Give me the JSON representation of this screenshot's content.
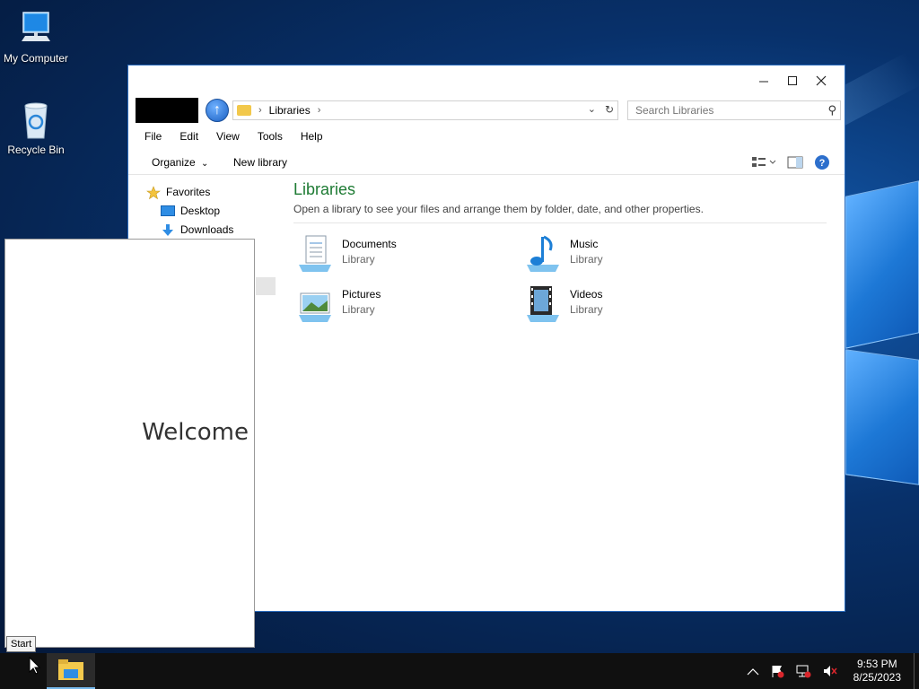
{
  "desktop": {
    "icons": [
      {
        "label": "My Computer",
        "icon": "computer-icon"
      },
      {
        "label": "Recycle Bin",
        "icon": "recycle-bin-icon"
      }
    ]
  },
  "explorer": {
    "address": {
      "crumbs": [
        "Libraries"
      ]
    },
    "search": {
      "placeholder": "Search Libraries"
    },
    "menu": [
      "File",
      "Edit",
      "View",
      "Tools",
      "Help"
    ],
    "commands": {
      "organize": "Organize",
      "new_library": "New library"
    },
    "nav": {
      "items": [
        {
          "label": "Favorites",
          "icon": "star-icon"
        },
        {
          "label": "Desktop",
          "icon": "desktop-icon"
        },
        {
          "label": "Downloads",
          "icon": "downloads-icon"
        }
      ]
    },
    "content": {
      "title": "Libraries",
      "description": "Open a library to see your files and arrange them by folder, date, and other properties.",
      "libraries": [
        {
          "name": "Documents",
          "type": "Library",
          "icon": "documents-icon"
        },
        {
          "name": "Music",
          "type": "Library",
          "icon": "music-icon"
        },
        {
          "name": "Pictures",
          "type": "Library",
          "icon": "pictures-icon"
        },
        {
          "name": "Videos",
          "type": "Library",
          "icon": "videos-icon"
        }
      ]
    }
  },
  "welcome": {
    "text": "Welcome"
  },
  "tooltip": {
    "start": "Start"
  },
  "taskbar": {
    "clock_time": "9:53 PM",
    "clock_date": "8/25/2023"
  },
  "colors": {
    "library_title": "#1e7b34",
    "taskbar": "#101010",
    "accent": "#76b9ed"
  }
}
